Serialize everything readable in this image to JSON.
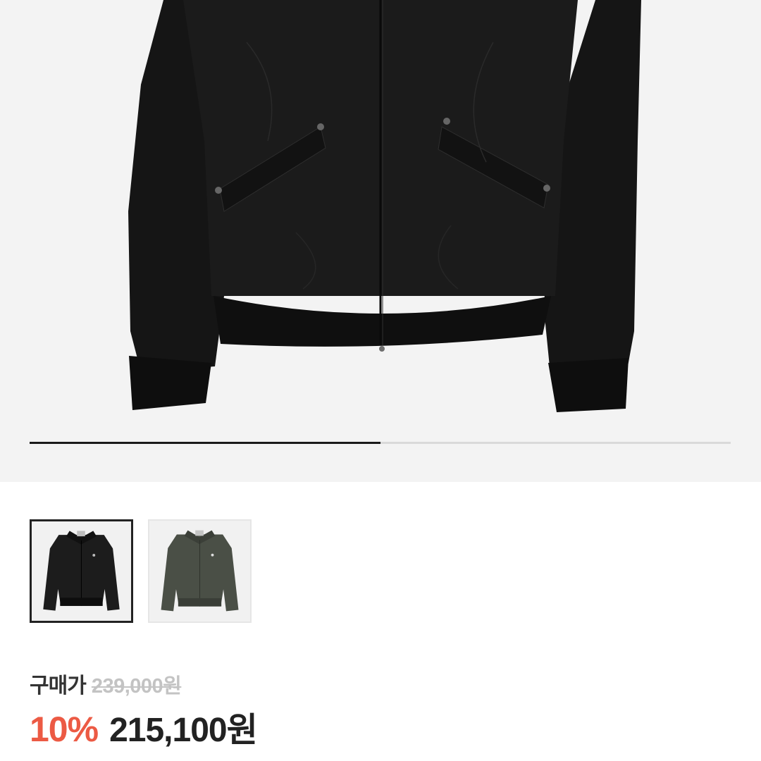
{
  "gallery": {
    "image_alt": "black zip-up bomber jacket",
    "progress_fraction": 0.5,
    "thumbnails": [
      {
        "color_name": "black",
        "swatch": "#1c1c1c",
        "selected": true
      },
      {
        "color_name": "olive khaki",
        "swatch": "#4a4f46",
        "selected": false
      }
    ]
  },
  "price": {
    "label": "구매가",
    "original": "239,000원",
    "discount": "10%",
    "final": "215,100원"
  },
  "colors": {
    "accent_discount": "#ec5a44",
    "hero_bg": "#f3f3f3",
    "progress_active": "#1a1a1a",
    "progress_track": "#d9d9d9"
  }
}
